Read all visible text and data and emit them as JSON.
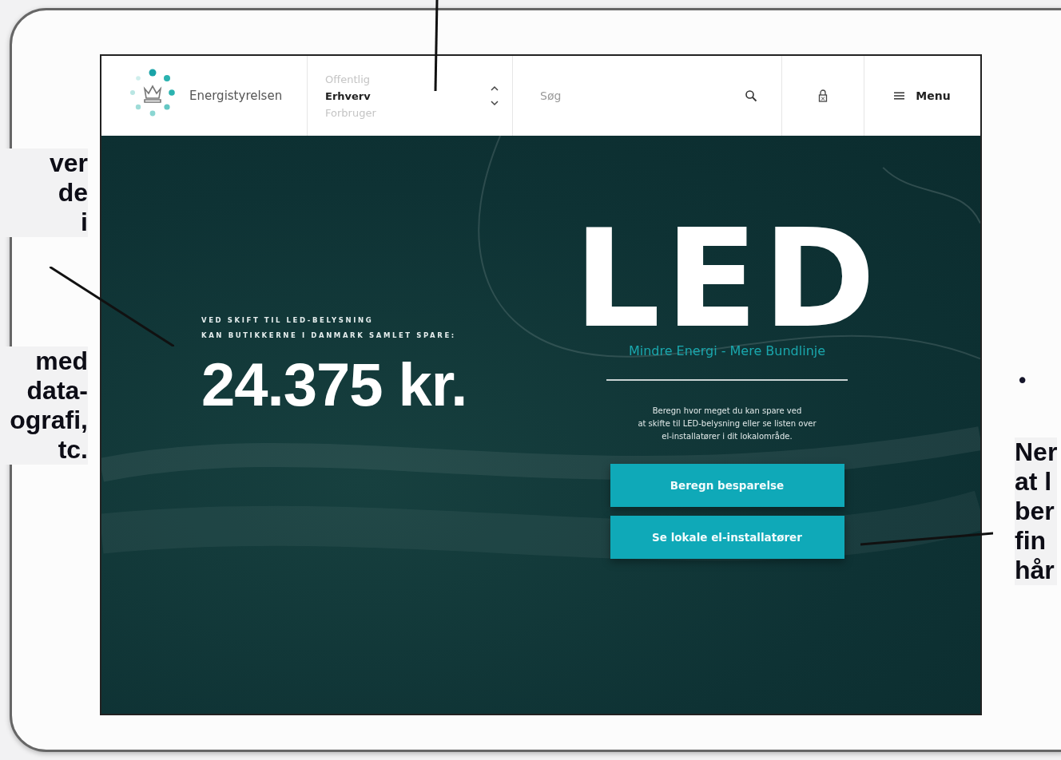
{
  "header": {
    "logo_text": "Energistyrelsen",
    "segments": [
      {
        "label": "Offentlig",
        "selected": false
      },
      {
        "label": "Erhverv",
        "selected": true
      },
      {
        "label": "Forbruger",
        "selected": false
      }
    ],
    "search": {
      "placeholder": "Søg"
    },
    "menu_label": "Menu"
  },
  "hero": {
    "eyebrow_lines": [
      "VED SKIFT TIL LED-BELYSNING",
      "KAN BUTIKKERNE I DANMARK SAMLET SPARE:"
    ],
    "amount": "24.375 kr.",
    "logo_word": "LED",
    "tagline": "Mindre Energi - Mere Bundlinje",
    "description_lines": [
      "Beregn hvor meget du kan spare ved",
      "at skifte til LED-belysning eller se listen over",
      "el-installatører i dit lokalområde."
    ],
    "buttons": [
      "Beregn besparelse",
      "Se lokale el-installatører"
    ]
  },
  "annotations": [
    {
      "lines": [
        "ver",
        "de",
        "i"
      ]
    },
    {
      "lines": [
        "med",
        "data-",
        "ografi,",
        "tc."
      ]
    },
    {
      "lines": [
        "Ner",
        "at l",
        "ber",
        "fin",
        "hår"
      ]
    }
  ],
  "bullet": "•"
}
